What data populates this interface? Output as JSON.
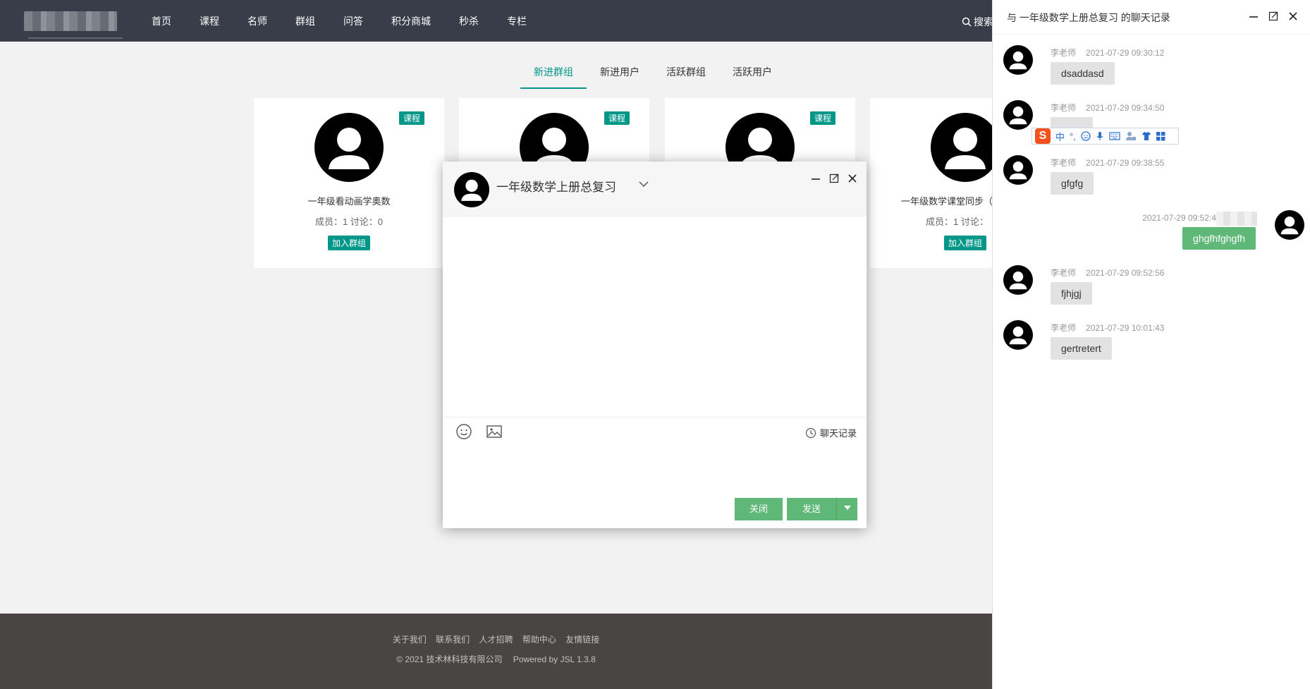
{
  "nav": {
    "items": [
      "首页",
      "课程",
      "名师",
      "群组",
      "问答",
      "积分商城",
      "秒杀",
      "专栏"
    ],
    "search_label": "搜索"
  },
  "tabs": [
    "新进群组",
    "新进用户",
    "活跃群组",
    "活跃用户"
  ],
  "cards": [
    {
      "badge": "课程",
      "name": "一年级看动画学奥数",
      "stats": "成员：1   讨论：0",
      "join": "加入群组"
    },
    {
      "badge": "课程",
      "name": "",
      "stats": "",
      "join": ""
    },
    {
      "badge": "课程",
      "name": "",
      "stats": "",
      "join": ""
    },
    {
      "badge": "",
      "name": "一年级数学课堂同步（",
      "stats": "成员：1   讨论：",
      "join": "加入群组"
    }
  ],
  "chat": {
    "title": "一年级数学上册总复习",
    "history_link": "聊天记录",
    "close_label": "关闭",
    "send_label": "发送"
  },
  "history": {
    "title": "与 一年级数学上册总复习 的聊天记录",
    "messages": [
      {
        "who": "李老师",
        "time": "2021-07-29 09:30:12",
        "text": "dsaddasd",
        "mine": false
      },
      {
        "who": "李老师",
        "time": "2021-07-29 09:34:50",
        "text": "",
        "mine": false
      },
      {
        "who": "李老师",
        "time": "2021-07-29 09:38:55",
        "text": "gfgfg",
        "mine": false
      },
      {
        "who": "",
        "time": "2021-07-29 09:52:4",
        "text": "ghgfhfghgfh",
        "mine": true
      },
      {
        "who": "李老师",
        "time": "2021-07-29 09:52:56",
        "text": "fjhjgj",
        "mine": false
      },
      {
        "who": "李老师",
        "time": "2021-07-29 10:01:43",
        "text": "gertretert",
        "mine": false
      }
    ]
  },
  "ime": {
    "mode": "中",
    "punct": "°,"
  },
  "footer": {
    "links": [
      "关于我们",
      "联系我们",
      "人才招聘",
      "帮助中心",
      "友情链接"
    ],
    "copyright": "© 2021 技术林科技有限公司",
    "powered": "Powered by JSL 1.3.8"
  },
  "colors": {
    "accent": "#009688",
    "button": "#5fb878",
    "topbar": "#393d49",
    "footer": "#484544"
  }
}
